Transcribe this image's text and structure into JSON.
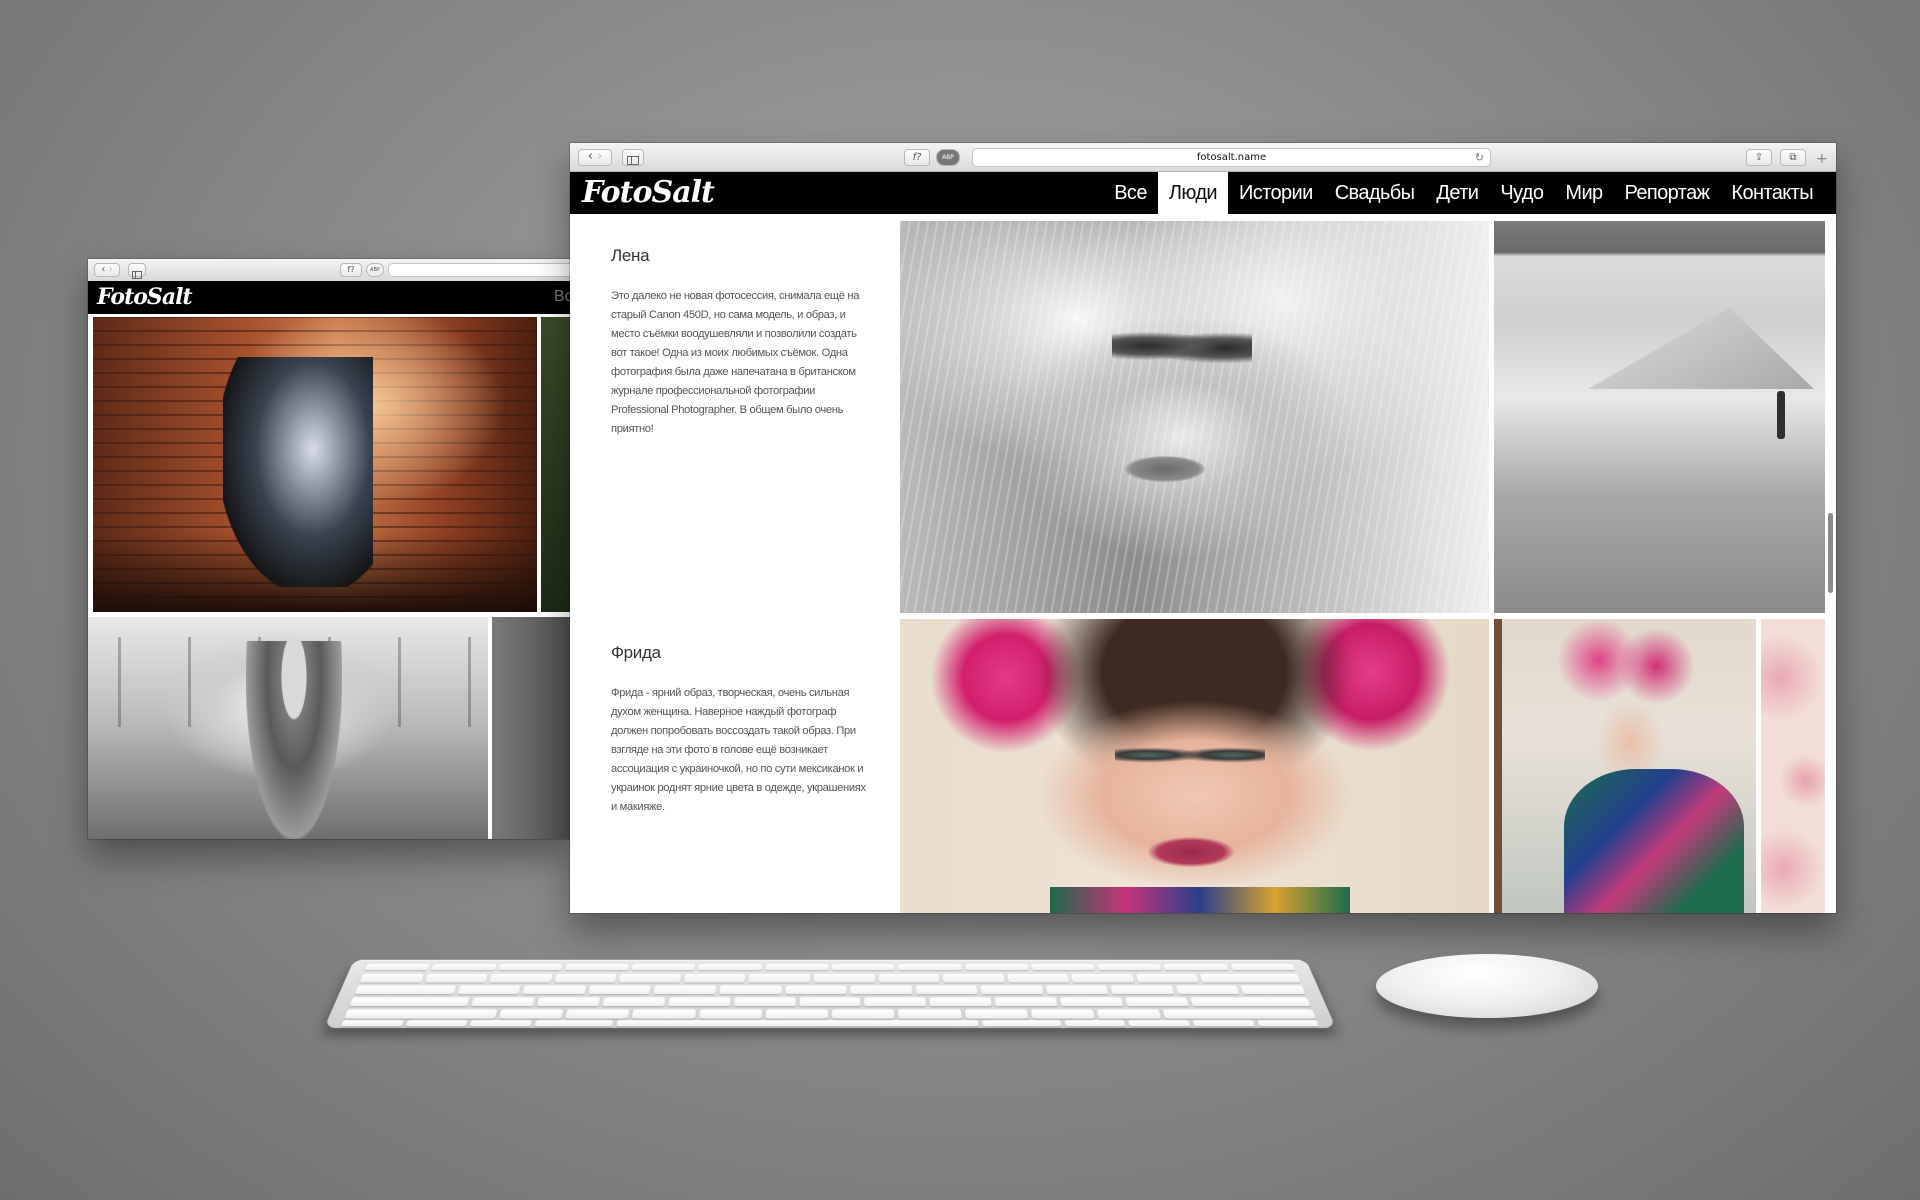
{
  "browser": {
    "url": "fotosalt.name",
    "back_glyph": "‹",
    "forward_glyph": "›",
    "reader_label": "f?",
    "adblock_label": "ABP",
    "reload_glyph": "↻",
    "share_glyph": "⇪",
    "tabs_glyph": "⧉",
    "new_tab_glyph": "+"
  },
  "site": {
    "logo": "FotoSalt",
    "nav": [
      {
        "label": "Все",
        "active": false
      },
      {
        "label": "Люди",
        "active": true
      },
      {
        "label": "Истории",
        "active": false
      },
      {
        "label": "Свадьбы",
        "active": false
      },
      {
        "label": "Дети",
        "active": false
      },
      {
        "label": "Чудо",
        "active": false
      },
      {
        "label": "Мир",
        "active": false
      },
      {
        "label": "Репортаж",
        "active": false
      },
      {
        "label": "Контакты",
        "active": false
      }
    ],
    "nav_partial": "Вс",
    "stories": [
      {
        "title": "Лена",
        "text": "Это далеко не новая фотосессия, снимала ещё на старый Canon 450D, но сама модель, и образ, и место съёмки воодушевляли и позволили создать вот такое! Одна из моих любимых съёмок. Одна фотография была даже напечатана в британском журнале профессиональной фотографии Professional Photographer. В общем было очень приятно!"
      },
      {
        "title": "Фрида",
        "text": "Фрида - ярний образ, творческая, очень сильная духом женщина. Наверное наждый фотограф должен попробовать воссоздать такой образ. При взгляде на эти фото в голове ещё возникает ассоциация с украиночкой, но по сути мексиканок и украинок роднят ярние цвета в одежде, украшениях и макияже."
      }
    ]
  },
  "colors": {
    "nav_bg": "#000000",
    "nav_text": "#ffffff",
    "active_bg": "#ffffff",
    "active_text": "#111111"
  },
  "icons": {
    "back": "chevron-left-icon",
    "forward": "chevron-right-icon",
    "sidebar": "sidebar-icon",
    "reload": "reload-icon",
    "share": "share-icon",
    "tabs": "tabs-icon"
  }
}
